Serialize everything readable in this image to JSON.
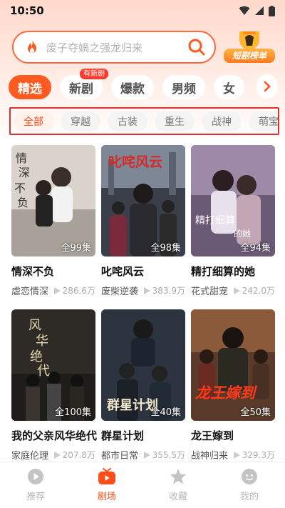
{
  "status_bar": {
    "time": "10:50"
  },
  "search": {
    "placeholder": "废子夺嫡之强龙归来"
  },
  "ranking": {
    "label": "短剧榜单"
  },
  "tabs": [
    {
      "label": "精选",
      "active": true
    },
    {
      "label": "新剧",
      "badge": "有新剧"
    },
    {
      "label": "爆款"
    },
    {
      "label": "男频"
    },
    {
      "label": "女"
    }
  ],
  "subtabs": [
    {
      "label": "全部",
      "active": true
    },
    {
      "label": "穿越"
    },
    {
      "label": "古装"
    },
    {
      "label": "重生"
    },
    {
      "label": "战神"
    },
    {
      "label": "萌宝"
    }
  ],
  "dramas": [
    {
      "title": "情深不负",
      "episodes": "全99集",
      "genre": "虐恋情深",
      "views": "286.6万",
      "cover_color": "#d9d3cc"
    },
    {
      "title": "叱咤风云",
      "episodes": "全98集",
      "genre": "废柴逆袭",
      "views": "383.9万",
      "cover_color": "#3a3f4a"
    },
    {
      "title": "精打细算的她",
      "episodes": "全94集",
      "genre": "花式甜宠",
      "views": "242.0万",
      "cover_color": "#6b5a76"
    },
    {
      "title": "我的父亲风华绝代",
      "episodes": "全100集",
      "genre": "家庭伦理",
      "views": "207.8万",
      "cover_color": "#2e2b26"
    },
    {
      "title": "群星计划",
      "episodes": "全40集",
      "genre": "都市日常",
      "views": "355.5万",
      "cover_color": "#2c3440"
    },
    {
      "title": "龙王嫁到",
      "episodes": "全50集",
      "genre": "战神归来",
      "views": "329.3万",
      "cover_color": "#5a3a2a"
    }
  ],
  "bottom_nav": [
    {
      "label": "推荐",
      "icon": "play-circle-icon"
    },
    {
      "label": "剧场",
      "icon": "tv-icon",
      "active": true
    },
    {
      "label": "收藏",
      "icon": "star-icon"
    },
    {
      "label": "我的",
      "icon": "face-icon"
    }
  ]
}
